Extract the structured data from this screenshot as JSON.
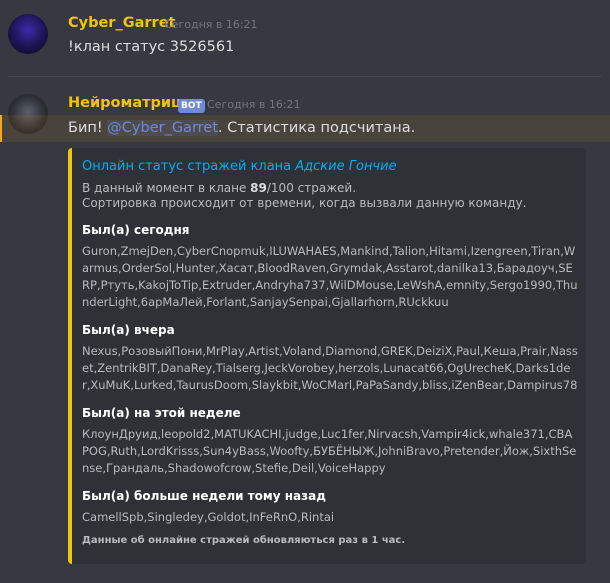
{
  "messages": [
    {
      "username": "Cyber_Garret",
      "timestamp": "Сегодня в 16:21",
      "content": "!клан статус 3526561"
    },
    {
      "username": "Нейроматрица",
      "bot_tag": "BOT",
      "timestamp": "Сегодня в 16:21",
      "content_prefix": "Бип! ",
      "mention": "@Cyber_Garret",
      "content_suffix": ". Статистика подсчитана."
    }
  ],
  "embed": {
    "color": "#f1c40f",
    "title_prefix": "Онлайн статус стражей клана ",
    "clan_name": "Адские Гончие",
    "desc_line1_prefix": "В данный момент в клане ",
    "desc_count": "89",
    "desc_line1_suffix": "/100 стражей.",
    "desc_line2": "Сортировка происходит от времени, когда вызвали данную команду.",
    "fields": [
      {
        "name": "Был(а) сегодня",
        "value": "Guron,ZmejDen,CyberCnopmuk,ILUWAHAES,Mankind,Talion,Hitami,Izengreen,Tiran,Warmus,OrderSol,Hunter,Хасат,BloodRaven,Grymdak,Asstarot,danilka13,Барадоуч,SERP,Ртуть,KakojToTip,Extruder,Andryha737,WilDMouse,LeWshA,emnity,Sergo1990,ThunderLight,6арМаЛей,Forlant,SanjaySenpai,Gjallarhorn,RUckkuu"
      },
      {
        "name": "Был(а) вчера",
        "value": "Nexus,РозовыйПони,MrPlay,Artist,Voland,Diamond,GREK,DeiziX,Paul,Кеша,Prair,Nasset,ZentrikBIT,DanaRey,Tialserg,JeckVorobey,herzols,Lunacat66,OgUrecheK,Darks1der,XuMuK,Lurked,TaurusDoom,Slaykbit,WoCMarl,PaPaSandy,bliss,iZenBear,Dampirus78"
      },
      {
        "name": "Был(а) на этой неделе",
        "value": "КлоунДруид,leopold2,MATUKACHI,judge,Luc1fer,Nirvacsh,Vampir4ick,whale371,CBAPOG,Ruth,LordKrisss,Sun4yBass,Woofty,БУБЁНЫЖ,JohniBravo,Pretender,Йож,SixthSense,Грандаль,Shadowofcrow,Stefie,Deil,VoiceHappy"
      },
      {
        "name": "Был(а) больше недели тому назад",
        "value": "CamellSpb,Singledey,Goldot,InFeRnO,Rintai"
      }
    ],
    "footer": "Данные об онлайне стражей обновляються раз в 1 час."
  }
}
